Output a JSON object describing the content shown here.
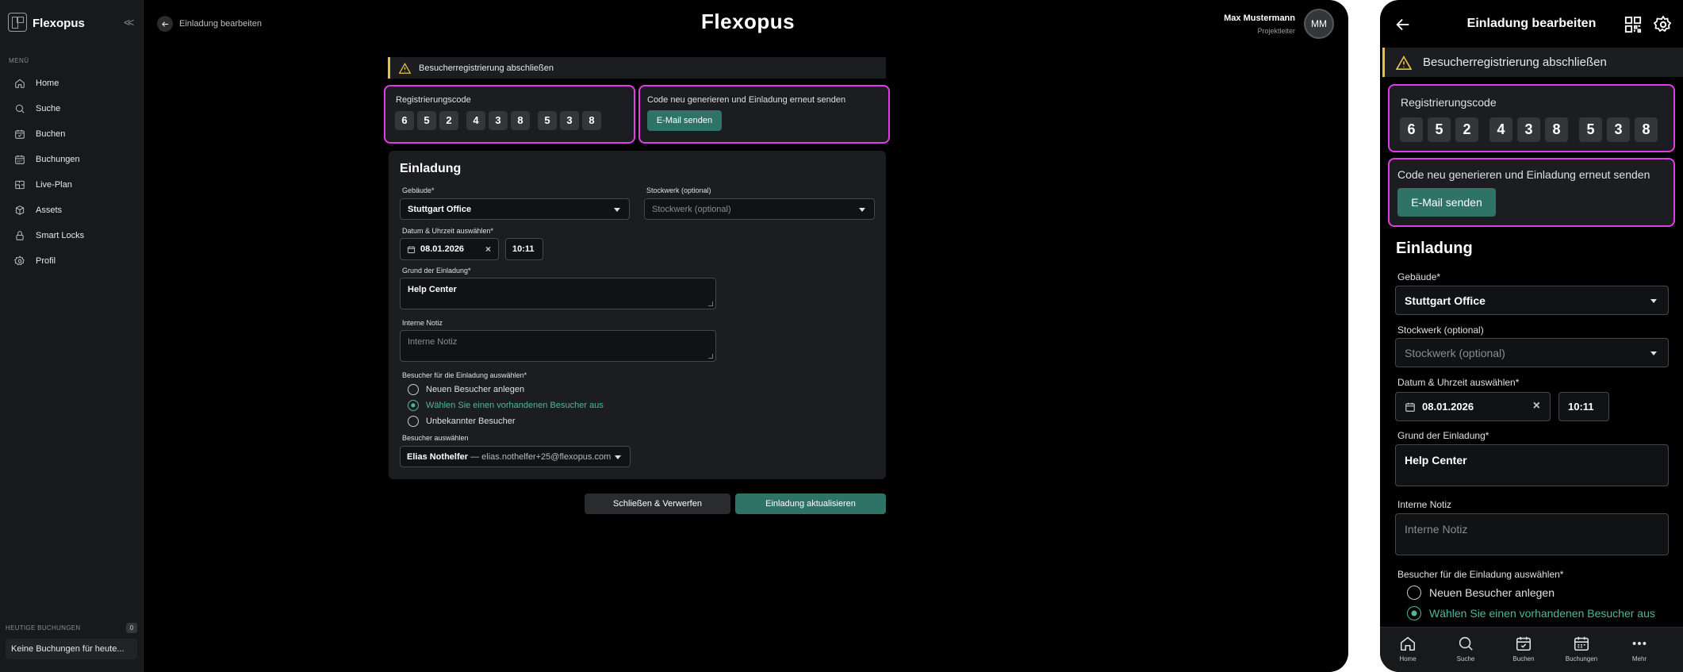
{
  "sidebar": {
    "brand": "Flexopus",
    "collapse_icon": "double-chevron-left-icon",
    "menu_label": "MENÜ",
    "items": [
      {
        "label": "Home",
        "icon": "home-icon"
      },
      {
        "label": "Suche",
        "icon": "search-icon"
      },
      {
        "label": "Buchen",
        "icon": "calendar-check-icon"
      },
      {
        "label": "Buchungen",
        "icon": "calendar-icon"
      },
      {
        "label": "Live-Plan",
        "icon": "map-icon"
      },
      {
        "label": "Assets",
        "icon": "box-icon"
      },
      {
        "label": "Smart Locks",
        "icon": "lock-icon"
      },
      {
        "label": "Profil",
        "icon": "gear-icon"
      }
    ],
    "today_label": "HEUTIGE BUCHUNGEN",
    "today_count": "0",
    "today_empty": "Keine Buchungen für heute..."
  },
  "header": {
    "breadcrumb": "Einladung bearbeiten",
    "app_title": "Flexopus",
    "user_name": "Max Mustermann",
    "user_role": "Projektleiter",
    "avatar_initials": "MM"
  },
  "alert": {
    "text": "Besucherregistrierung abschließen"
  },
  "registration": {
    "label": "Registrierungscode",
    "digits": [
      "6",
      "5",
      "2",
      "4",
      "3",
      "8",
      "5",
      "3",
      "8"
    ]
  },
  "resend": {
    "label": "Code neu generieren und Einladung erneut senden",
    "button": "E-Mail senden"
  },
  "form": {
    "title": "Einladung",
    "building_label": "Gebäude*",
    "building_value": "Stuttgart Office",
    "floor_label": "Stockwerk (optional)",
    "floor_placeholder": "Stockwerk (optional)",
    "datetime_label": "Datum & Uhrzeit auswählen*",
    "date_value": "08.01.2026",
    "time_value": "10:11",
    "reason_label": "Grund der Einladung*",
    "reason_value": "Help Center",
    "note_label": "Interne Notiz",
    "note_placeholder": "Interne Notiz",
    "visitor_label": "Besucher für die Einladung auswählen*",
    "visitor_options": [
      {
        "label": "Neuen Besucher anlegen",
        "selected": false
      },
      {
        "label": "Wählen Sie einen vorhandenen Besucher aus",
        "selected": true
      },
      {
        "label": "Unbekannter Besucher",
        "selected": false
      }
    ],
    "select_visitor_label": "Besucher auswählen",
    "visitor_name": "Elias Nothelfer",
    "visitor_email": " — elias.nothelfer+25@flexopus.com"
  },
  "actions": {
    "cancel": "Schließen & Verwerfen",
    "submit": "Einladung aktualisieren"
  },
  "mobile": {
    "title": "Einladung bearbeiten",
    "icons": [
      "arrow-left-icon",
      "qr-code-icon",
      "gear-icon"
    ],
    "nav": [
      {
        "label": "Home",
        "icon": "home-icon"
      },
      {
        "label": "Suche",
        "icon": "search-icon"
      },
      {
        "label": "Buchen",
        "icon": "calendar-check-icon"
      },
      {
        "label": "Buchungen",
        "icon": "calendar-icon"
      },
      {
        "label": "Mehr",
        "icon": "more-icon"
      }
    ]
  },
  "colors": {
    "accent": "#2e7268",
    "accent_text": "#52b59f",
    "warning": "#e9c046",
    "highlight": "#e23ce6",
    "background": "#000000",
    "surface": "#1c1d20"
  }
}
